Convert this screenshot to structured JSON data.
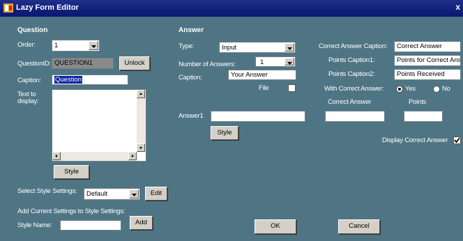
{
  "window": {
    "title": "Lazy Form Editor",
    "close_glyph": "x"
  },
  "question": {
    "header": "Question",
    "order_label": "Order:",
    "order_value": "1",
    "question_id_label": "QuestionID:",
    "question_id_value": "QUESTION1",
    "unlock_button": "Unlock",
    "caption_label": "Caption:",
    "caption_value": "Question",
    "text_to_display_label_1": "Text to",
    "text_to_display_label_2": "display:",
    "text_to_display_value": "",
    "style_button": "Style"
  },
  "style_settings": {
    "select_label": "Select Style Settings:",
    "selected": "Default",
    "edit_button": "Edit",
    "add_current_label": "Add Current Settings to Style Settings:",
    "style_name_label": "Style Name:",
    "style_name_value": "",
    "add_button": "Add"
  },
  "answer": {
    "header": "Answer",
    "type_label": "Type:",
    "type_value": "Input",
    "num_answers_label": "Number of Answers:",
    "num_answers_value": "1",
    "caption_label": "Caption:",
    "caption_value": "Your Answer",
    "file_label": "File",
    "file_checked": false,
    "answer1_label": "Answer1",
    "answer1_value": "",
    "style_button": "Style"
  },
  "correct": {
    "caption_label": "Correct Answer Caption:",
    "caption_value": "Correct Answer",
    "points1_label": "Points Caption1:",
    "points1_value": "Points for Correct Answer",
    "points2_label": "Points Caption2:",
    "points2_value": "Points Received",
    "with_correct_label": "With Correct Answer:",
    "yes_label": "Yes",
    "no_label": "No",
    "selected": "Yes",
    "correct_answer_col": "Correct Answer",
    "points_col": "Points",
    "correct_answer_value": "",
    "points_value": "",
    "display_label": "Display Correct Answer",
    "display_checked": true
  },
  "footer": {
    "ok_button": "OK",
    "cancel_button": "Cancel"
  }
}
